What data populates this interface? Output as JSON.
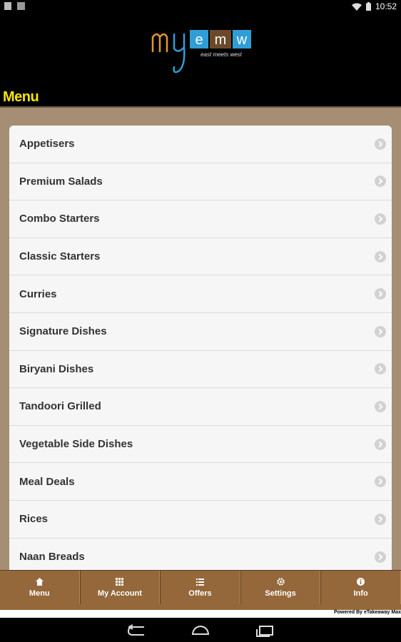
{
  "status_bar": {
    "time": "10:52",
    "icons": [
      "notification-icon",
      "photo-icon",
      "wifi-icon",
      "battery-icon"
    ]
  },
  "header": {
    "logo_text": "myemw",
    "logo_tagline": "east meets west"
  },
  "page": {
    "title": "Menu"
  },
  "menu": {
    "items": [
      {
        "label": "Appetisers"
      },
      {
        "label": "Premium Salads"
      },
      {
        "label": "Combo Starters"
      },
      {
        "label": "Classic Starters"
      },
      {
        "label": "Curries"
      },
      {
        "label": "Signature Dishes"
      },
      {
        "label": "Biryani Dishes"
      },
      {
        "label": "Tandoori Grilled"
      },
      {
        "label": "Vegetable Side Dishes"
      },
      {
        "label": "Meal Deals"
      },
      {
        "label": "Rices"
      },
      {
        "label": "Naan Breads"
      }
    ]
  },
  "tabbar": {
    "tabs": [
      {
        "label": "Menu",
        "icon": "home-icon"
      },
      {
        "label": "My Account",
        "icon": "grid-icon"
      },
      {
        "label": "Offers",
        "icon": "list-icon"
      },
      {
        "label": "Settings",
        "icon": "gear-icon"
      },
      {
        "label": "Info",
        "icon": "info-icon"
      }
    ]
  },
  "footer": {
    "powered_by": "Powered By eTakeaway Max"
  },
  "colors": {
    "title": "#f5e600",
    "content_bg": "#a58e73",
    "tabbar_bg": "#94683b",
    "logo_orange": "#e39a2b",
    "logo_blue": "#2f9ed6",
    "logo_brown": "#6b4a2c"
  }
}
